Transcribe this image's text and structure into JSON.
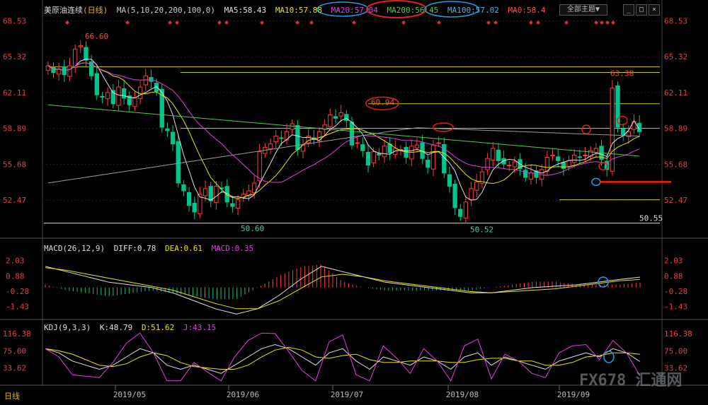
{
  "header": {
    "symbol": "美原油连续",
    "period": "(日线)",
    "ma_label": "MA(5,10,20,200,100,0)",
    "ma5": "MA5:58.43",
    "ma10": "MA10:57.88",
    "ma20": "MA20:57.04",
    "ma200": "MA200:56.45",
    "ma100": "MA100:57.02",
    "ma0": "MA0:58.4",
    "theme_button": "全部主题▼"
  },
  "macd_header": {
    "label": "MACD(26,12,9)",
    "diff": "DIFF:0.78",
    "dea": "DEA:0.61",
    "macd": "MACD:0.35"
  },
  "kdj_header": {
    "label": "KDJ(9,3,3)",
    "k": "K:48.79",
    "d": "D:51.62",
    "j": "J:43.15"
  },
  "footer": {
    "period_tab": "日线",
    "watermark": "FX678 汇通网"
  },
  "colors": {
    "up": "#ff3b3b",
    "down": "#00c48c",
    "ma_white": "#e0e0e0",
    "ma_yellow": "#e6e600",
    "ma_magenta": "#e040e0",
    "ma_green": "#50c850",
    "ma_gray": "#9a9a9a",
    "hline": "#c8c800"
  },
  "chart_data": [
    {
      "type": "candlestick",
      "title": "美原油连续(日线)",
      "x_ticks": [
        "2019/05",
        "2019/06",
        "2019/07",
        "2019/08",
        "2019/09"
      ],
      "y_ticks": [
        "68.53",
        "65.32",
        "62.11",
        "58.89",
        "55.68",
        "52.47"
      ],
      "ylim": [
        49.5,
        69.0
      ],
      "annotations": [
        "66.60",
        "60.94",
        "63.38",
        "50.60",
        "50.52",
        "50.55"
      ],
      "horizontal_levels": [
        64.4,
        63.9,
        61.1,
        58.9,
        52.5
      ],
      "closes": [
        64.5,
        63.9,
        64.2,
        63.7,
        64.5,
        66.0,
        66.3,
        65.0,
        63.6,
        61.9,
        61.7,
        62.1,
        61.1,
        62.6,
        61.6,
        61.0,
        61.7,
        62.6,
        63.6,
        63.1,
        62.2,
        59.0,
        58.7,
        57.5,
        54.0,
        53.3,
        52.0,
        51.4,
        53.0,
        53.5,
        52.4,
        53.7,
        53.5,
        52.3,
        51.9,
        52.5,
        53.0,
        53.3,
        54.0,
        56.8,
        57.2,
        57.5,
        58.2,
        58.0,
        58.6,
        59.3,
        57.0,
        57.4,
        58.2,
        57.9,
        58.6,
        59.2,
        60.1,
        59.8,
        60.3,
        59.6,
        57.4,
        57.6,
        56.9,
        55.6,
        56.8,
        56.5,
        57.3,
        56.7,
        57.1,
        57.0,
        56.3,
        57.3,
        57.4,
        56.2,
        55.4,
        57.4,
        57.6,
        54.9,
        53.7,
        51.8,
        51.0,
        52.3,
        53.5,
        54.1,
        55.0,
        56.2,
        57.1,
        56.0,
        55.7,
        55.6,
        55.9,
        55.3,
        54.5,
        54.9,
        54.5,
        55.2,
        56.3,
        56.5,
        56.0,
        55.3,
        56.0,
        56.5,
        56.3,
        56.5,
        56.9,
        57.1,
        56.1,
        55.2,
        62.5,
        59.0,
        58.3,
        58.6,
        59.5,
        58.6
      ],
      "ma_values": {
        "MA5": 58.43,
        "MA10": 57.88,
        "MA20": 57.04,
        "MA200": 56.45,
        "MA100": 57.02,
        "MA0": 58.4
      }
    },
    {
      "type": "bar+line",
      "title": "MACD(26,12,9)",
      "y_ticks": [
        "2.03",
        "0.88",
        "-0.28",
        "-1.43"
      ],
      "ylim": [
        -2.2,
        2.6
      ],
      "diff_points": [
        1.6,
        1.2,
        0.8,
        0.4,
        0.2,
        0.0,
        -0.4,
        -1.0,
        -1.6,
        -2.0,
        -1.6,
        -0.6,
        0.6,
        1.6,
        1.2,
        0.8,
        0.4,
        0.2,
        0.0,
        -0.2,
        -0.4,
        -0.4,
        -0.2,
        0.0,
        0.1,
        0.2,
        0.4,
        0.6,
        0.78
      ],
      "dea_points": [
        1.5,
        1.3,
        1.0,
        0.7,
        0.4,
        0.1,
        -0.2,
        -0.7,
        -1.2,
        -1.6,
        -1.6,
        -1.0,
        -0.1,
        0.8,
        1.0,
        0.8,
        0.5,
        0.3,
        0.1,
        -0.1,
        -0.3,
        -0.4,
        -0.3,
        -0.2,
        -0.1,
        0.1,
        0.3,
        0.5,
        0.61
      ],
      "latest": {
        "DIFF": 0.78,
        "DEA": 0.61,
        "MACD": 0.35
      }
    },
    {
      "type": "line",
      "title": "KDJ(9,3,3)",
      "y_ticks": [
        "116.38",
        "75.00",
        "33.62"
      ],
      "ylim": [
        0,
        120
      ],
      "k_points": [
        80,
        70,
        50,
        40,
        30,
        40,
        60,
        80,
        70,
        40,
        30,
        40,
        30,
        20,
        40,
        60,
        80,
        90,
        80,
        60,
        40,
        70,
        80,
        50,
        30,
        60,
        50,
        40,
        60,
        50,
        30,
        60,
        70,
        40,
        60,
        50,
        40,
        30,
        50,
        60,
        70,
        60,
        80,
        70,
        48.79
      ],
      "latest": {
        "K": 48.79,
        "D": 51.62,
        "J": 43.15
      }
    }
  ]
}
